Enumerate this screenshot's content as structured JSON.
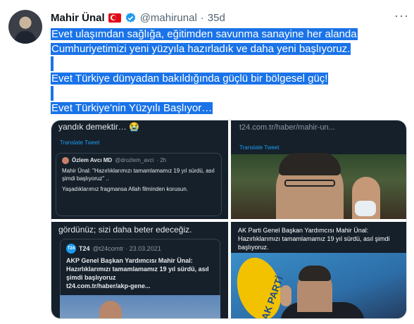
{
  "tweet": {
    "author_name": "Mahir Ünal",
    "handle": "@mahirunal",
    "separator": "·",
    "time": "35d",
    "more_label": "···",
    "flag_icon": "turkey-flag-icon",
    "verified_icon": "verified-badge-icon",
    "accent_color": "#1d9bf0",
    "selection_color": "#1a73e8",
    "text_lines": [
      "Evet ulaşımdan sağlığa, eğitimden savunma sanayine her alanda",
      "Cumhuriyetimizi yeni yüzyıla hazırladık ve daha yeni başlıyoruz.",
      "",
      "Evet Türkiye dünyadan bakıldığında güçlü bir bölgesel güç!",
      "",
      "Evet Türkiye'nin Yüzyılı Başlıyor…"
    ]
  },
  "media": {
    "image1": {
      "top_text": "yandık demektir… 😭",
      "translate_label": "Translate Tweet",
      "quote": {
        "author": "Özlem Avcı MD",
        "handle": "@drozlem_avci",
        "time": "· 2h",
        "line1": "Mahir Ünal: \"Hazırlıklarımızı tamamlamamız 19 yıl sürdü, asıl şimdi başlıyoruz\" ..",
        "line2": "Yaşadıklarımız fragmansa Allah filminden korusun."
      }
    },
    "image2": {
      "link_text": "t24.com.tr/haber/mahir-un...",
      "translate_label": "Translate Tweet"
    },
    "image3": {
      "top_text": "gördünüz; sizi daha beter edeceğiz.",
      "card": {
        "logo": "T24",
        "name": "T24",
        "handle": "@t24comtr · 23.03.2021",
        "headline": "AKP Genel Başkan Yardımcısı Mahir Ünal: Hazırlıklarımızı tamamlamamız 19 yıl sürdü, asıl şimdi başlıyoruz",
        "link": "t24.com.tr/haber/akp-gene..."
      }
    },
    "image4": {
      "caption_bold": "AK Parti Genel Başkan Yardımcısı Mahir Ünal:",
      "caption_rest": "Hazırlıklarımızı tamamlamamız 19 yıl sürdü, asıl şimdi başlıyoruz.",
      "banner_text": "AK PARTİ"
    }
  }
}
